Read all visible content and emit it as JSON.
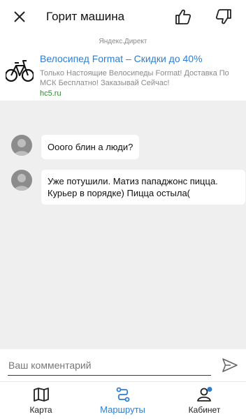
{
  "header": {
    "title": "Горит машина"
  },
  "ad": {
    "source": "Яндекс.Директ",
    "title": "Велосипед Format – Скидки до 40%",
    "text": "Только Настоящие Велосипеды Format! Доставка По МСК Бесплатно! Заказывай Сейчас!",
    "domain": "hc5.ru"
  },
  "comments": [
    {
      "text": "Ооого блин а люди?"
    },
    {
      "text": "Уже потушили. Матиз пападжонс пицца. Курьер в порядке) Пицца остыла("
    }
  ],
  "composer": {
    "placeholder": "Ваш комментарий"
  },
  "tabs": [
    {
      "label": "Карта",
      "icon": "map-icon"
    },
    {
      "label": "Маршруты",
      "icon": "route-icon",
      "active": true
    },
    {
      "label": "Кабинет",
      "icon": "profile-icon"
    }
  ],
  "colors": {
    "accent": "#2f7dd1",
    "ad_domain": "#2e8a2e",
    "notification_dot": "#2f7dd1"
  }
}
